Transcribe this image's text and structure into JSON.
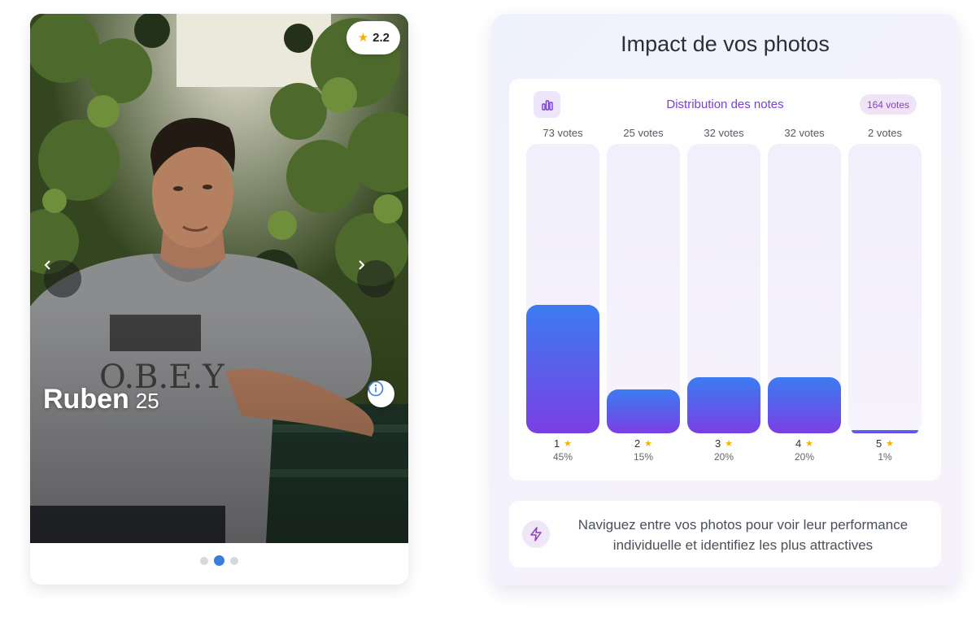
{
  "profile": {
    "rating": "2.2",
    "name": "Ruben",
    "age": "25",
    "photo_alt": "Photo de profil"
  },
  "carousel": {
    "total": 3,
    "active_index": 1
  },
  "stats": {
    "title": "Impact de vos photos",
    "distribution_title": "Distribution des notes",
    "total_votes": "164 votes",
    "bars": [
      {
        "votes_label": "73 votes",
        "stars": "1",
        "percent": "45%",
        "fraction": 0.445
      },
      {
        "votes_label": "25 votes",
        "stars": "2",
        "percent": "15%",
        "fraction": 0.152
      },
      {
        "votes_label": "32 votes",
        "stars": "3",
        "percent": "20%",
        "fraction": 0.195
      },
      {
        "votes_label": "32 votes",
        "stars": "4",
        "percent": "20%",
        "fraction": 0.195
      },
      {
        "votes_label": "2 votes",
        "stars": "5",
        "percent": "1%",
        "fraction": 0.012
      }
    ],
    "tip": "Naviguez entre vos photos pour voir leur performance individuelle et identifiez les plus attractives"
  },
  "icons": {
    "rating": "star-icon",
    "prev": "chevron-left-icon",
    "next": "chevron-right-icon",
    "info": "info-icon",
    "chart": "bar-chart-icon",
    "tip": "lightning-icon"
  },
  "colors": {
    "accent_blue": "#3b7cf0",
    "accent_purple": "#7b3fe4",
    "star": "#f4b400",
    "active_dot": "#3b7ddd"
  }
}
